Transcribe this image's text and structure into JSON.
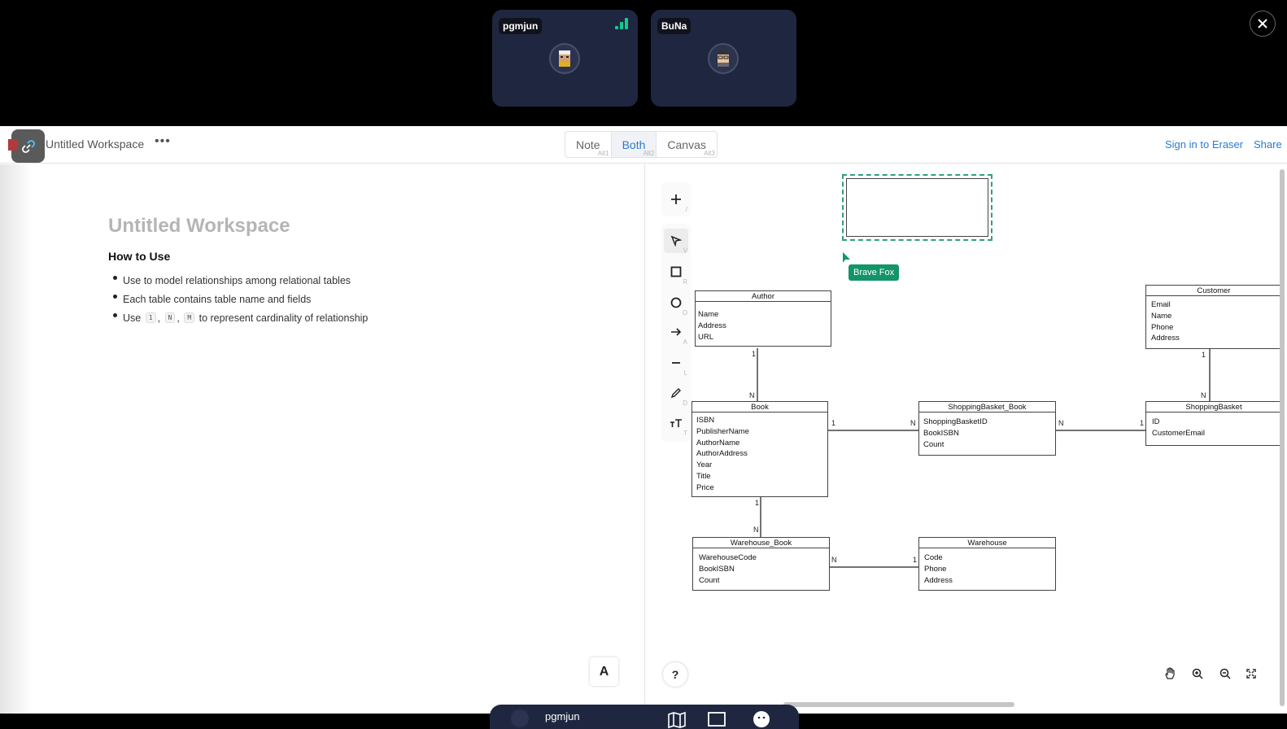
{
  "participants": [
    {
      "name": "pgmjun",
      "signal": "strong"
    },
    {
      "name": "BuNa"
    }
  ],
  "header": {
    "workspace_title": "Untitled Workspace",
    "more_label": "•••",
    "view_modes": [
      {
        "label": "Note",
        "shortcut": "Alt1"
      },
      {
        "label": "Both",
        "shortcut": "Alt2",
        "active": true
      },
      {
        "label": "Canvas",
        "shortcut": "Alt3"
      }
    ],
    "sign_in_label": "Sign in to Eraser",
    "share_label": "Share"
  },
  "note": {
    "title": "Untitled Workspace",
    "heading": "How to Use",
    "bullet1": "Use to model relationships among relational tables",
    "bullet2": "Each table contains table name and fields",
    "bullet3_pre": "Use",
    "bullet3_codes": [
      "1",
      "N",
      "M"
    ],
    "bullet3_sep": ",",
    "bullet3_post": "to represent cardinality of relationship",
    "format_button": "A"
  },
  "canvas": {
    "tools": [
      {
        "icon": "plus-icon",
        "key": "/"
      },
      {
        "icon": "select-pointer-icon",
        "key": "V",
        "active": true
      },
      {
        "icon": "rectangle-icon",
        "key": "R"
      },
      {
        "icon": "circle-icon",
        "key": "O"
      },
      {
        "icon": "arrow-icon",
        "key": "A"
      },
      {
        "icon": "line-icon",
        "key": "L"
      },
      {
        "icon": "pencil-icon",
        "key": "D"
      },
      {
        "icon": "text-icon",
        "key": "T"
      }
    ],
    "cursor_user": "Brave Fox",
    "help_label": "?",
    "tables": {
      "author": {
        "name": "Author",
        "fields": [
          "Name",
          "Address",
          "URL"
        ]
      },
      "book": {
        "name": "Book",
        "fields": [
          "ISBN",
          "PublisherName",
          "AuthorName",
          "AuthorAddress",
          "Year",
          "Title",
          "Price"
        ]
      },
      "customer": {
        "name": "Customer",
        "fields": [
          "Email",
          "Name",
          "Phone",
          "Address"
        ]
      },
      "shopping_basket_book": {
        "name": "ShoppingBasket_Book",
        "fields": [
          "ShoppingBasketID",
          "BookISBN",
          "Count"
        ]
      },
      "shopping_basket": {
        "name": "ShoppingBasket",
        "fields": [
          "ID",
          "CustomerEmail"
        ]
      },
      "warehouse_book": {
        "name": "Warehouse_Book",
        "fields": [
          "WarehouseCode",
          "BookISBN",
          "Count"
        ]
      },
      "warehouse": {
        "name": "Warehouse",
        "fields": [
          "Code",
          "Phone",
          "Address"
        ]
      }
    },
    "cardinalities": {
      "author_book_a": "1",
      "author_book_b": "N",
      "book_sbb_a": "1",
      "book_sbb_b": "N",
      "sbb_sb_a": "N",
      "sbb_sb_b": "1",
      "cust_sb_a": "1",
      "cust_sb_b": "N",
      "book_wb_a": "1",
      "book_wb_b": "N",
      "wb_wh_a": "N",
      "wb_wh_b": "1"
    }
  },
  "bottom_bar": {
    "user": "pgmjun"
  },
  "colors": {
    "accent": "#2b7bd0",
    "cursor": "#13946a",
    "signal": "#16c98d",
    "tile": "#1f2740"
  }
}
